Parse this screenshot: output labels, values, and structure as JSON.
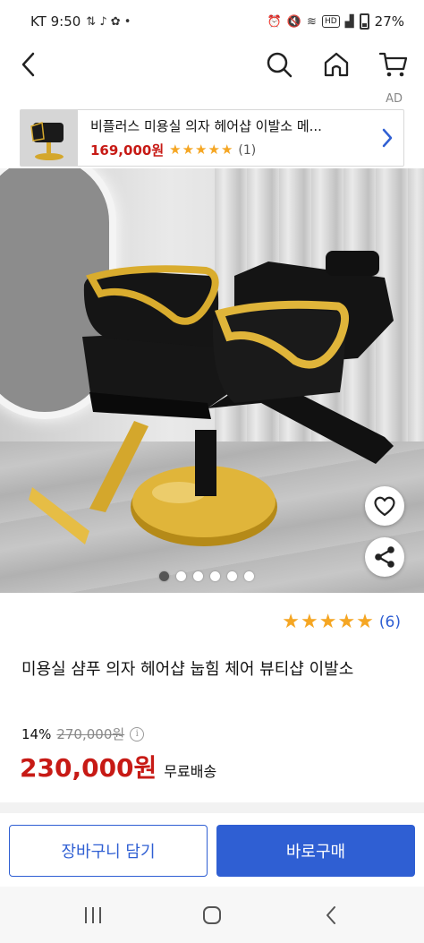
{
  "status_bar": {
    "carrier_time": "KT 9:50",
    "battery": "27%",
    "hd_badge": "HD"
  },
  "ad": {
    "label": "AD",
    "title": "비플러스 미용실 의자 헤어샵 이발소 메...",
    "price": "169,000원",
    "rating": 5,
    "review_count": "(1)"
  },
  "product": {
    "rating": 5,
    "review_count": "(6)",
    "title": "미용실 샴푸 의자 헤어샵 눕힘 체어 뷰티샵 이발소",
    "discount_rate": "14%",
    "original_price": "270,000원",
    "sale_price": "230,000원",
    "shipping": "무료배송",
    "image_count": 6,
    "active_image_index": 0
  },
  "actions": {
    "add_to_cart": "장바구니 담기",
    "buy_now": "바로구매"
  },
  "colors": {
    "brand_blue": "#2f5fd3",
    "price_red": "#c71a15",
    "star": "#f5a623"
  },
  "icons": [
    "back-icon",
    "search-icon",
    "home-icon",
    "cart-icon",
    "chevron-right-icon",
    "heart-icon",
    "share-icon",
    "info-icon"
  ]
}
